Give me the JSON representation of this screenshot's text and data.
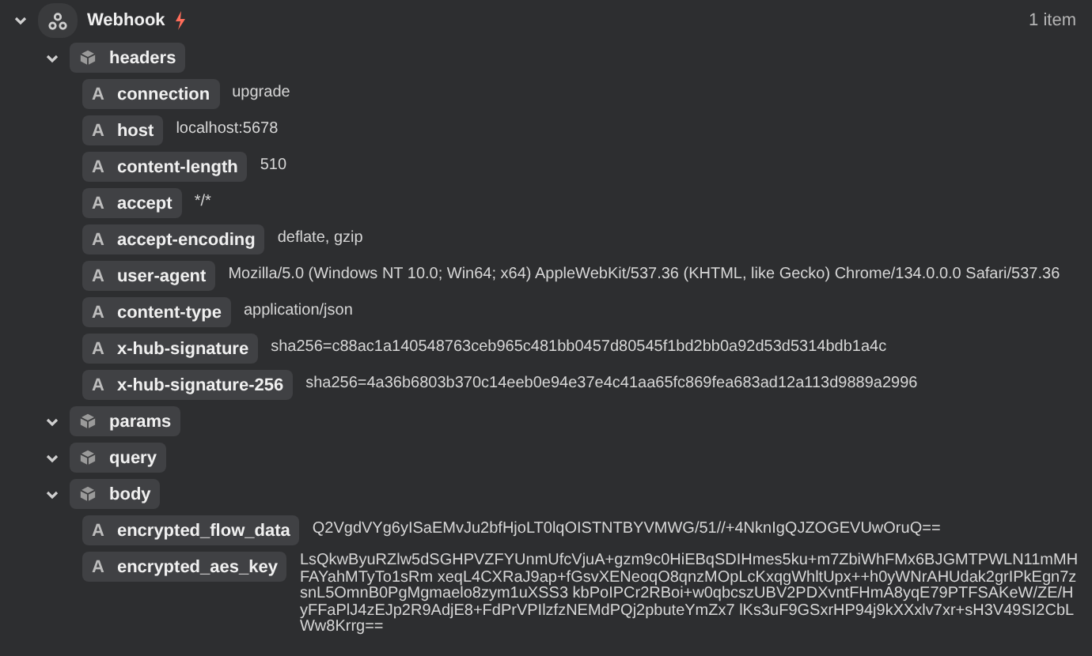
{
  "root": {
    "label": "Webhook",
    "count": "1 item",
    "expanded": true,
    "children": [
      {
        "kind": "object",
        "key": "headers",
        "expanded": true,
        "children": [
          {
            "kind": "string",
            "type_label": "A",
            "key": "connection",
            "value": "upgrade"
          },
          {
            "kind": "string",
            "type_label": "A",
            "key": "host",
            "value": "localhost:5678"
          },
          {
            "kind": "string",
            "type_label": "A",
            "key": "content-length",
            "value": "510"
          },
          {
            "kind": "string",
            "type_label": "A",
            "key": "accept",
            "value": "*/*"
          },
          {
            "kind": "string",
            "type_label": "A",
            "key": "accept-encoding",
            "value": "deflate, gzip"
          },
          {
            "kind": "string",
            "type_label": "A",
            "key": "user-agent",
            "value": "Mozilla/5.0 (Windows NT 10.0; Win64; x64) AppleWebKit/537.36 (KHTML, like Gecko) Chrome/134.0.0.0 Safari/537.36"
          },
          {
            "kind": "string",
            "type_label": "A",
            "key": "content-type",
            "value": "application/json"
          },
          {
            "kind": "string",
            "type_label": "A",
            "key": "x-hub-signature",
            "value": "sha256=c88ac1a140548763ceb965c481bb0457d80545f1bd2bb0a92d53d5314bdb1a4c"
          },
          {
            "kind": "string",
            "type_label": "A",
            "key": "x-hub-signature-256",
            "value": "sha256=4a36b6803b370c14eeb0e94e37e4c41aa65fc869fea683ad12a113d9889a2996"
          }
        ]
      },
      {
        "kind": "object",
        "key": "params",
        "expanded": true
      },
      {
        "kind": "object",
        "key": "query",
        "expanded": true
      },
      {
        "kind": "object",
        "key": "body",
        "expanded": true,
        "children": [
          {
            "kind": "string",
            "type_label": "A",
            "key": "encrypted_flow_data",
            "value": "Q2VgdVYg6yISaEMvJu2bfHjoLT0lqOISTNTBYVMWG/51//+4NknIgQJZOGEVUwOruQ=="
          },
          {
            "kind": "string",
            "type_label": "A",
            "key": "encrypted_aes_key",
            "value": "LsQkwByuRZlw5dSGHPVZFYUnmUfcVjuA+gzm9c0HiEBqSDIHmes5ku+m7ZbiWhFMx6BJGMTPWLN11mMHFAYahMTyTo1sRm xeqL4CXRaJ9ap+fGsvXENeoqO8qnzMOpLcKxqgWhltUpx++h0yWNrAHUdak2grIPkEgn7zsnL5OmnB0PgMgmaelo8zym1uXSS3 kbPoIPCr2RBoi+w0qbcszUBV2PDXvntFHmA8yqE79PTFSAKeW/ZE/HyFFaPlJ4zEJp2R9AdjE8+FdPrVPIlzfzNEMdPQj2pbuteYmZx7 lKs3uF9GSxrHP94j9kXXxlv7xr+sH3V49SI2CbLWw8Krrg=="
          }
        ]
      }
    ]
  }
}
